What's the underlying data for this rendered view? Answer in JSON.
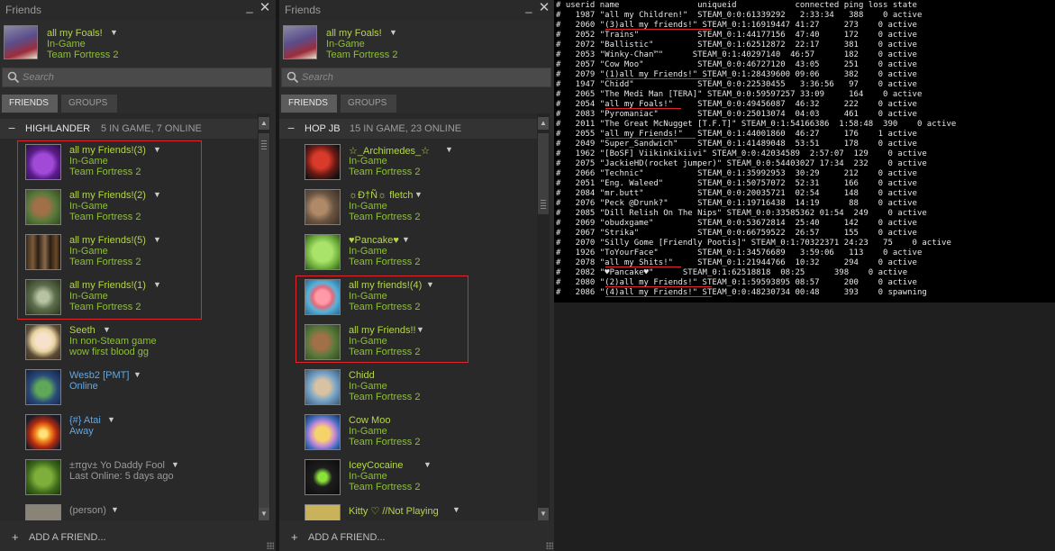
{
  "panels": [
    {
      "title": "Friends",
      "self": {
        "name": "all my Foals!",
        "status": "In-Game",
        "game": "Team Fortress 2"
      },
      "search_placeholder": "Search",
      "tabs": [
        "FRIENDS",
        "GROUPS"
      ],
      "group": {
        "name": "HIGHLANDER",
        "count": "5 IN GAME, 7 ONLINE"
      },
      "friends": [
        {
          "name": "all my Friends!(3)",
          "status": "In-Game",
          "game": "Team Fortress 2",
          "state": "ingame",
          "avatar": "purple-cat"
        },
        {
          "name": "all my Friends!(2)",
          "status": "In-Game",
          "game": "Team Fortress 2",
          "state": "ingame",
          "avatar": "wolf"
        },
        {
          "name": "all my Friends!(5)",
          "status": "In-Game",
          "game": "Team Fortress 2",
          "state": "ingame",
          "avatar": "group-photo"
        },
        {
          "name": "all my Friends!(1)",
          "status": "In-Game",
          "game": "Team Fortress 2",
          "state": "ingame",
          "avatar": "ghost"
        },
        {
          "name": "Seeth",
          "status": "In non-Steam game",
          "game": "wow first blood gg",
          "state": "ingame",
          "avatar": "anime-girl"
        },
        {
          "name": "Wesb2 [PMT]",
          "status": "Online",
          "game": "",
          "state": "online",
          "avatar": "zombie-face"
        },
        {
          "name": "{#} Atai",
          "status": "Away",
          "game": "",
          "state": "online",
          "avatar": "explosion"
        },
        {
          "name": "±πgv± Yo Daddy Fool",
          "status": "Last Online: 5 days ago",
          "game": "",
          "state": "offline",
          "avatar": "green-monster"
        },
        {
          "name": "(person)",
          "status": "",
          "game": "",
          "state": "offline",
          "avatar": "grey"
        }
      ],
      "add_friend": "ADD A FRIEND..."
    },
    {
      "title": "Friends",
      "self": {
        "name": "all my Foals!",
        "status": "In-Game",
        "game": "Team Fortress 2"
      },
      "search_placeholder": "Search",
      "tabs": [
        "FRIENDS",
        "GROUPS"
      ],
      "group": {
        "name": "HOP JB",
        "count": "15 IN GAME, 23 ONLINE"
      },
      "friends": [
        {
          "name": "☆_Archimedes_☆",
          "status": "In-Game",
          "game": "Team Fortress 2",
          "state": "ingame",
          "avatar": "red-bird"
        },
        {
          "name": "☼Ð†Ñ☼ fletch",
          "status": "In-Game",
          "game": "Team Fortress 2",
          "state": "ingame",
          "avatar": "wolf-dark"
        },
        {
          "name": "♥Pancake♥",
          "status": "In-Game",
          "game": "Team Fortress 2",
          "state": "ingame",
          "avatar": "green-block"
        },
        {
          "name": "all my friends!(4)",
          "status": "In-Game",
          "game": "Team Fortress 2",
          "state": "ingame",
          "avatar": "starfish"
        },
        {
          "name": "all my Friends!!",
          "status": "In-Game",
          "game": "Team Fortress 2",
          "state": "ingame",
          "avatar": "wolf"
        },
        {
          "name": "Chidd",
          "status": "In-Game",
          "game": "Team Fortress 2",
          "state": "ingame",
          "avatar": "hands"
        },
        {
          "name": "Cow Moo",
          "status": "In-Game",
          "game": "Team Fortress 2",
          "state": "ingame",
          "avatar": "pony"
        },
        {
          "name": "IceyCocaine",
          "status": "In-Game",
          "game": "Team Fortress 2",
          "state": "ingame",
          "avatar": "monster-energy"
        },
        {
          "name": "Kitty ♡ //Not Playing",
          "status": "",
          "game": "",
          "state": "ingame",
          "avatar": "yellow"
        }
      ],
      "add_friend": "ADD A FRIEND..."
    }
  ],
  "console": {
    "header": "# userid name                uniqueid            connected ping loss state",
    "lines": [
      "#   1987 \"all my Children!\"  STEAM_0:0:61339292   2:33:34   388    0 active",
      "#   2060 \"(3)all my friends!\" STEAM_0:1:16919447 41:27     273    0 active",
      "#   2052 \"Trains\"            STEAM_0:1:44177156  47:40     172    0 active",
      "#   2072 \"Ballistic\"         STEAM_0:1:62512872  22:17     381    0 active",
      "#   2053 \"Winky-Chan™\"      STEAM_0:1:40297140  46:57      182    0 active",
      "#   2057 \"Cow Moo\"           STEAM_0:0:46727120  43:05     251    0 active",
      "#   2079 \"(1)all my Friends!\" STEAM_0:1:28439600 09:06     382    0 active",
      "#   1947 \"Chidd\"             STEAM_0:0:22530455   3:36:56   97    0 active",
      "#   2065 \"The Medi Man [TERA]\" STEAM_0:0:59597257 33:09     164    0 active",
      "#   2054 \"all my Foals!\"     STEAM_0:0:49456087  46:32     222    0 active",
      "#   2083 \"Pyromaniac\"        STEAM_0:0:25013074  04:03     461    0 active",
      "#   2011 \"The Great McNugget [T.F.T]\" STEAM_0:1:54166386  1:58:48  390    0 active",
      "#   2055 \"all my Friends!\"   STEAM_0:1:44001860  46:27     176    1 active",
      "#   2049 \"Super_Sandwich\"    STEAM_0:1:41489048  53:51     178    0 active",
      "#   1962 \"[BoSF] Viikinkikiivi\" STEAM_0:0:42034589  2:57:07  129    0 active",
      "#   2075 \"JackieHD(rocket jumper)\" STEAM_0:0:54403027 17:34  232    0 active",
      "#   2066 \"Technic\"           STEAM_0:1:35992953  30:29     212    0 active",
      "#   2051 \"Eng. Waleed\"       STEAM_0:1:50757072  52:31     166    0 active",
      "#   2084 \"mr.butt\"           STEAM_0:0:20035721  02:54     148    0 active",
      "#   2076 \"Peck @Drunk?\"      STEAM_0:1:19716438  14:19      88    0 active",
      "#   2085 \"Dill Relish On The Nips\" STEAM_0:0:33585362 01:54  249    0 active",
      "#   2069 \"obudxgame\"         STEAM_0:0:53672814  25:40     142    0 active",
      "#   2067 \"Strika\"            STEAM_0:0:66759522  26:57     155    0 active",
      "#   2070 \"Silly Gome [Friendly Pootis]\" STEAM_0:1:70322371 24:23   75    0 active",
      "#   1926 \"ToYourFace\"        STEAM_0:1:34576689   3:59:06   113    0 active",
      "#   2078 \"all my Shits!\"     STEAM_0:1:21944766  10:32     294    0 active",
      "#   2082 \"♥Pancake♥\"      STEAM_0:1:62518818  08:25      398    0 active",
      "#   2080 \"(2)all my Friends!\" STEAM_0:1:59593895 08:57     200    0 active",
      "#   2086 \"(4)all my Friends!\" STEAM_0:0:48230734 00:48     393    0 spawning"
    ]
  },
  "colors": {
    "ingame_name": "#b5d64b",
    "ingame_text": "#8ebe3c",
    "online_text": "#62a7e3",
    "offline_text": "#9a9a9a",
    "highlight_border": "#e0262b"
  }
}
